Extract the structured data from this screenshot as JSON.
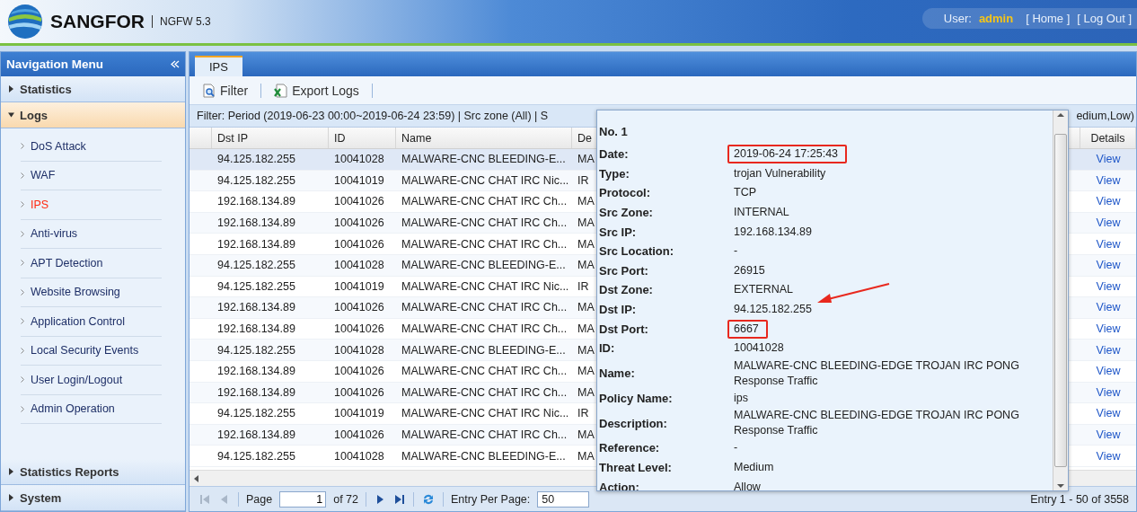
{
  "header": {
    "brand": "SANGFOR",
    "product": "NGFW 5.3",
    "user_label": "User:",
    "user": "admin",
    "links": [
      "[ Home ]",
      "[ Log Out ]"
    ]
  },
  "nav": {
    "title": "Navigation Menu",
    "sections": [
      {
        "label": "Statistics",
        "expanded": false
      },
      {
        "label": "Logs",
        "expanded": true,
        "items": [
          {
            "label": "DoS Attack",
            "selected": false
          },
          {
            "label": "WAF",
            "selected": false
          },
          {
            "label": "IPS",
            "selected": true
          },
          {
            "label": "Anti-virus",
            "selected": false
          },
          {
            "label": "APT Detection",
            "selected": false
          },
          {
            "label": "Website Browsing",
            "selected": false
          },
          {
            "label": "Application Control",
            "selected": false
          },
          {
            "label": "Local Security Events",
            "selected": false
          },
          {
            "label": "User Login/Logout",
            "selected": false
          },
          {
            "label": "Admin Operation",
            "selected": false
          }
        ]
      }
    ],
    "bottom_sections": [
      {
        "label": "Statistics Reports",
        "expanded": false
      },
      {
        "label": "System",
        "expanded": false
      }
    ]
  },
  "tabs": [
    {
      "label": "IPS",
      "selected": true
    }
  ],
  "toolbar": [
    {
      "label": "Filter",
      "kind": "filter"
    },
    {
      "label": "Export Logs",
      "kind": "export"
    }
  ],
  "filter": {
    "text": "Filter: Period (2019-06-23 00:00~2019-06-24 23:59) | Src zone (All) | S",
    "text_end": "edium,Low)"
  },
  "table": {
    "columns": [
      "Dst IP",
      "ID",
      "Name",
      "De",
      "Details"
    ],
    "rows": [
      {
        "dst_ip": "94.125.182.255",
        "id": "10041028",
        "name": "MALWARE-CNC BLEEDING-E...",
        "column_4": "MA",
        "details": "View",
        "selected": true
      },
      {
        "dst_ip": "94.125.182.255",
        "id": "10041019",
        "name": "MALWARE-CNC CHAT IRC Nic...",
        "column_4": "IR",
        "details": "View",
        "selected": false
      },
      {
        "dst_ip": "192.168.134.89",
        "id": "10041026",
        "name": "MALWARE-CNC CHAT IRC Ch...",
        "column_4": "MA",
        "details": "View",
        "selected": false
      },
      {
        "dst_ip": "192.168.134.89",
        "id": "10041026",
        "name": "MALWARE-CNC CHAT IRC Ch...",
        "column_4": "MA",
        "details": "View",
        "selected": false
      },
      {
        "dst_ip": "192.168.134.89",
        "id": "10041026",
        "name": "MALWARE-CNC CHAT IRC Ch...",
        "column_4": "MA",
        "details": "View",
        "selected": false
      },
      {
        "dst_ip": "94.125.182.255",
        "id": "10041028",
        "name": "MALWARE-CNC BLEEDING-E...",
        "column_4": "MA",
        "details": "View",
        "selected": false
      },
      {
        "dst_ip": "94.125.182.255",
        "id": "10041019",
        "name": "MALWARE-CNC CHAT IRC Nic...",
        "column_4": "IR",
        "details": "View",
        "selected": false
      },
      {
        "dst_ip": "192.168.134.89",
        "id": "10041026",
        "name": "MALWARE-CNC CHAT IRC Ch...",
        "column_4": "MA",
        "details": "View",
        "selected": false
      },
      {
        "dst_ip": "192.168.134.89",
        "id": "10041026",
        "name": "MALWARE-CNC CHAT IRC Ch...",
        "column_4": "MA",
        "details": "View",
        "selected": false
      },
      {
        "dst_ip": "94.125.182.255",
        "id": "10041028",
        "name": "MALWARE-CNC BLEEDING-E...",
        "column_4": "MA",
        "details": "View",
        "selected": false
      },
      {
        "dst_ip": "192.168.134.89",
        "id": "10041026",
        "name": "MALWARE-CNC CHAT IRC Ch...",
        "column_4": "MA",
        "details": "View",
        "selected": false
      },
      {
        "dst_ip": "192.168.134.89",
        "id": "10041026",
        "name": "MALWARE-CNC CHAT IRC Ch...",
        "column_4": "MA",
        "details": "View",
        "selected": false
      },
      {
        "dst_ip": "94.125.182.255",
        "id": "10041019",
        "name": "MALWARE-CNC CHAT IRC Nic...",
        "column_4": "IR",
        "details": "View",
        "selected": false
      },
      {
        "dst_ip": "192.168.134.89",
        "id": "10041026",
        "name": "MALWARE-CNC CHAT IRC Ch...",
        "column_4": "MA",
        "details": "View",
        "selected": false
      },
      {
        "dst_ip": "94.125.182.255",
        "id": "10041028",
        "name": "MALWARE-CNC BLEEDING-E...",
        "column_4": "MA",
        "details": "View",
        "selected": false
      }
    ]
  },
  "pager": {
    "page_label": "Page",
    "page": "1",
    "of": "of 72",
    "per_page_label": "Entry Per Page:",
    "per_page": "50",
    "summary": "Entry 1 - 50 of 3558"
  },
  "details_popup": {
    "title": "No. 1",
    "fields": [
      {
        "label": "Date:",
        "value": "2019-06-24 17:25:43",
        "highlighted": true,
        "arrow": false
      },
      {
        "label": "Type:",
        "value": "trojan Vulnerability",
        "highlighted": false,
        "arrow": false
      },
      {
        "label": "Protocol:",
        "value": "TCP",
        "highlighted": false,
        "arrow": false
      },
      {
        "label": "Src Zone:",
        "value": "INTERNAL",
        "highlighted": false,
        "arrow": false
      },
      {
        "label": "Src IP:",
        "value": "192.168.134.89",
        "highlighted": false,
        "arrow": false
      },
      {
        "label": "Src Location:",
        "value": "-",
        "highlighted": false,
        "arrow": false
      },
      {
        "label": "Src Port:",
        "value": "26915",
        "highlighted": false,
        "arrow": false
      },
      {
        "label": "Dst Zone:",
        "value": "EXTERNAL",
        "highlighted": false,
        "arrow": false
      },
      {
        "label": "Dst IP:",
        "value": "94.125.182.255",
        "highlighted": false,
        "arrow": true
      },
      {
        "label": "Dst Port:",
        "value": "6667",
        "highlighted": true,
        "arrow": false
      },
      {
        "label": "ID:",
        "value": "10041028",
        "highlighted": false,
        "arrow": false
      },
      {
        "label": "Name:",
        "value": "MALWARE-CNC BLEEDING-EDGE TROJAN IRC PONG Response Traffic",
        "highlighted": false,
        "arrow": false
      },
      {
        "label": "Policy Name:",
        "value": "ips",
        "highlighted": false,
        "arrow": false
      },
      {
        "label": "Description:",
        "value": "MALWARE-CNC BLEEDING-EDGE TROJAN IRC PONG Response Traffic",
        "highlighted": false,
        "arrow": false
      },
      {
        "label": "Reference:",
        "value": "-",
        "highlighted": false,
        "arrow": false
      },
      {
        "label": "Threat Level:",
        "value": "Medium",
        "highlighted": false,
        "arrow": false
      },
      {
        "label": "Action:",
        "value": "Allow",
        "highlighted": false,
        "arrow": false
      }
    ]
  }
}
